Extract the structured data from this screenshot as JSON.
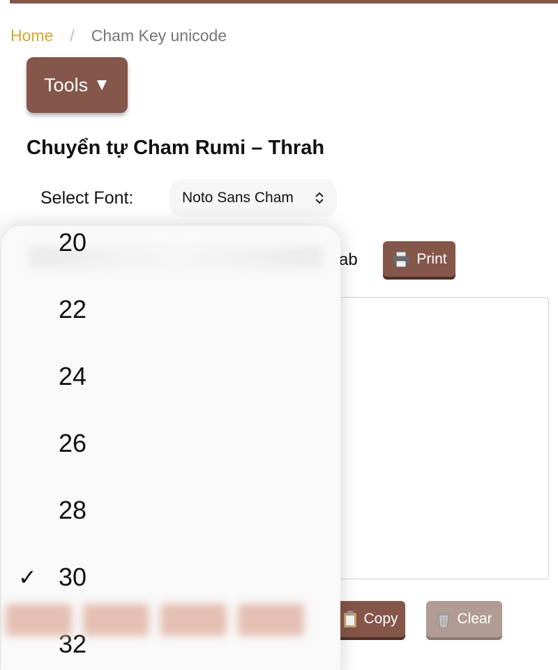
{
  "breadcrumb": {
    "home": "Home",
    "separator": "/",
    "current": "Cham Key unicode"
  },
  "tools_button": {
    "label": "Tools",
    "caret": "▼"
  },
  "page_title": "Chuyển tự Cham Rumi – Thrah",
  "font_select": {
    "label": "Select Font:",
    "value": "Noto Sans Cham",
    "chevron": "⌃⌄"
  },
  "partial_text": "ab",
  "print_button": {
    "icon": "printer-icon",
    "label": "Print"
  },
  "copy_button": {
    "icon": "clipboard-icon",
    "label": "Copy"
  },
  "clear_button": {
    "icon": "trash-icon",
    "label": "Clear"
  },
  "size_picker": {
    "options": [
      "20",
      "22",
      "24",
      "26",
      "28",
      "30",
      "32"
    ],
    "selected": "30",
    "check_mark": "✓"
  },
  "colors": {
    "brand": "#85564a",
    "link": "#d4a72c",
    "disabled": "#b09c93"
  }
}
